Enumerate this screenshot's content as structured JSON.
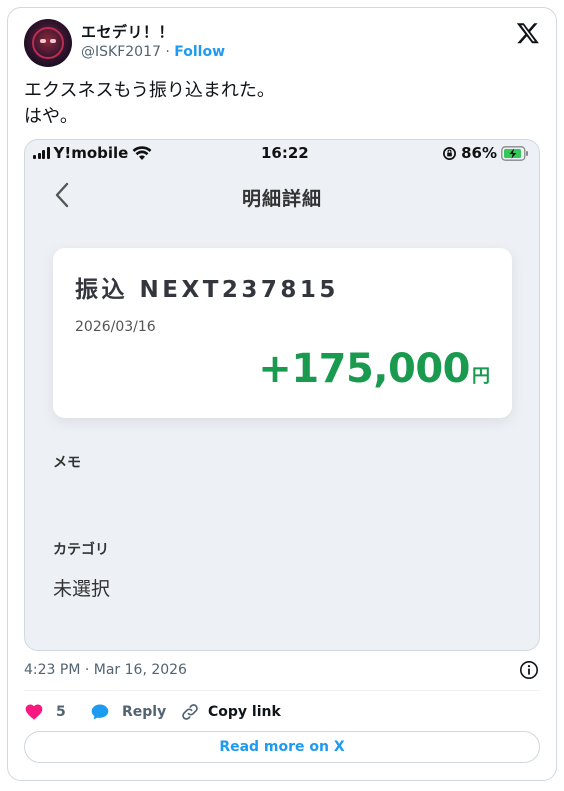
{
  "author": {
    "name": "エセデリ！！",
    "handle": "@ISKF2017",
    "separator": "·",
    "follow_label": "Follow"
  },
  "tweet": {
    "text_line1": "エクスネスもう振り込まれた。",
    "text_line2": "はや。",
    "timestamp": "4:23 PM · Mar 16, 2026"
  },
  "screenshot": {
    "status_bar": {
      "carrier": "Y!mobile",
      "time": "16:22",
      "battery": "86%"
    },
    "nav_title": "明細詳細",
    "transaction": {
      "title": "振込 NEXT237815",
      "date": "2026/03/16",
      "amount": "+175,000",
      "currency": "円",
      "amount_color": "#1a9a4f"
    },
    "memo_label": "メモ",
    "category_label": "カテゴリ",
    "category_value": "未選択"
  },
  "actions": {
    "like_count": "5",
    "reply_label": "Reply",
    "copy_link_label": "Copy link"
  },
  "read_more_label": "Read more on X",
  "colors": {
    "accent": "#1d9bf0",
    "like": "#f91880",
    "text_secondary": "#536471"
  }
}
